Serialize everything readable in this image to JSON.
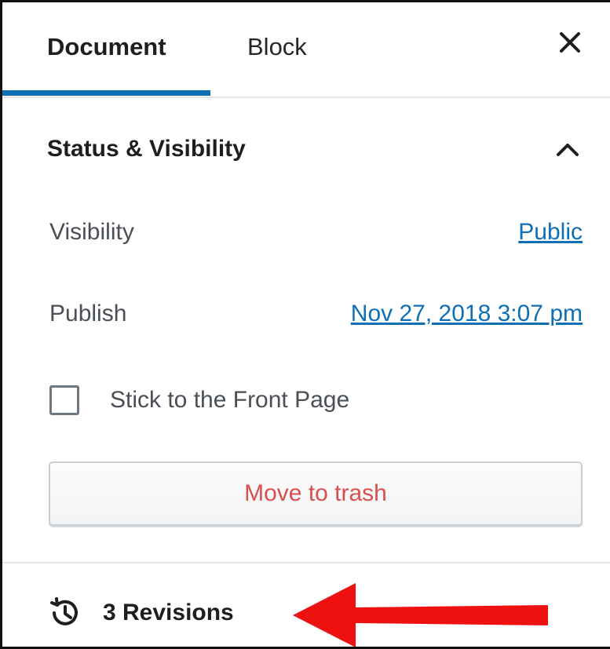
{
  "tabs": {
    "document_label": "Document",
    "block_label": "Block",
    "active": "Document",
    "close_icon": "close-icon"
  },
  "panel": {
    "title": "Status & Visibility",
    "expanded": true,
    "toggle_icon": "chevron-up-icon",
    "visibility": {
      "label": "Visibility",
      "value": "Public"
    },
    "publish": {
      "label": "Publish",
      "value": "Nov 27, 2018 3:07 pm"
    },
    "sticky": {
      "label": "Stick to the Front Page",
      "checked": false
    },
    "trash_label": "Move to trash"
  },
  "revisions": {
    "label": "3 Revisions",
    "icon": "history-icon"
  },
  "annotation": {
    "icon": "red-arrow-icon",
    "color": "#ee1111"
  },
  "colors": {
    "accent": "#0e6fb5",
    "trash_text": "#d94f4f",
    "arrow": "#ee1111"
  }
}
